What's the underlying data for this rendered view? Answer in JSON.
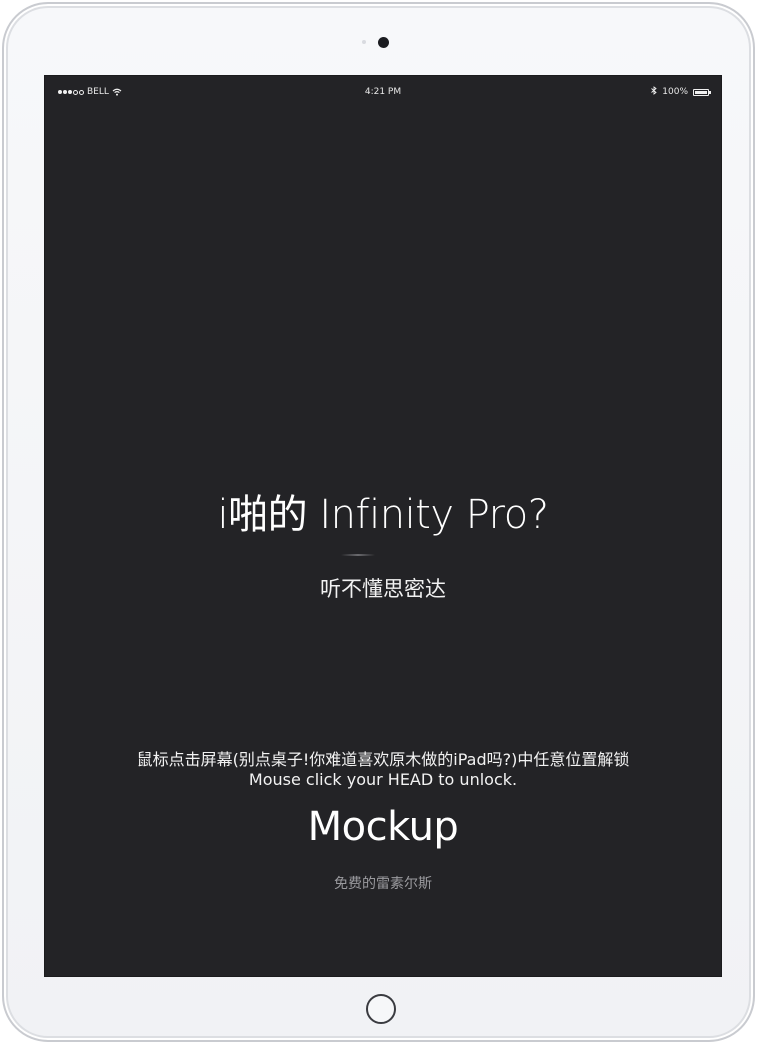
{
  "status_bar": {
    "carrier": "BELL",
    "time": "4:21 PM",
    "battery_percent": "100%",
    "battery_level": 1.0,
    "signal_icon": "signal-dots-icon",
    "wifi_icon": "wifi-icon",
    "bluetooth_icon": "bluetooth-icon",
    "battery_icon": "battery-icon"
  },
  "lock_screen": {
    "headline": "i啪的 Infinity Pro?",
    "subtitle": "听不懂思密达",
    "unlock_hint_cn": "鼠标点击屏幕(别点桌子!你难道喜欢原木做的iPad吗?)中任意位置解锁",
    "unlock_hint_en": "Mouse click your HEAD to unlock.",
    "brand": "Mockup",
    "brand_sub": "免费的雷素尔斯"
  },
  "device": {
    "home_button_icon": "home-button-icon",
    "camera_icon": "camera-icon"
  },
  "colors": {
    "screen_background": "#232326",
    "bezel": "#f3f4f6",
    "text_primary": "#ffffff",
    "text_muted": "#9a9a9e"
  }
}
